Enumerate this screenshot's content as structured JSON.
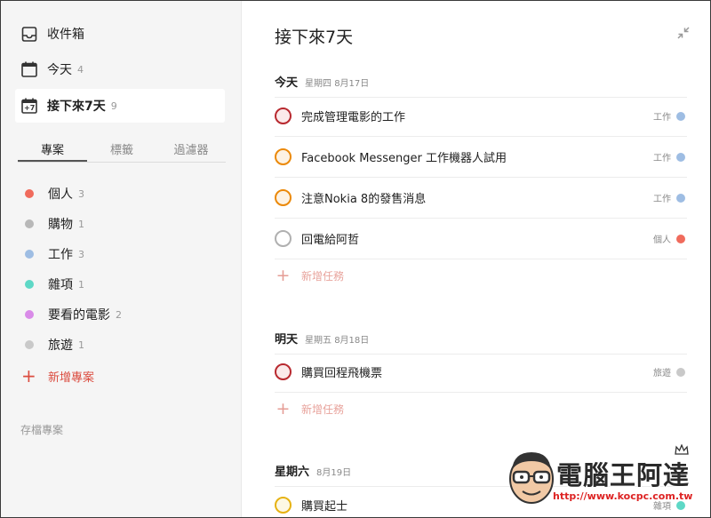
{
  "sidebar": {
    "nav": [
      {
        "label": "收件箱",
        "count": "",
        "icon": "inbox-icon"
      },
      {
        "label": "今天",
        "count": "4",
        "icon": "calendar-icon"
      },
      {
        "label": "接下來7天",
        "count": "9",
        "icon": "calendar-plus7-icon",
        "icon_text": "+7"
      }
    ],
    "tabs": [
      "專案",
      "標籤",
      "過濾器"
    ],
    "projects": [
      {
        "label": "個人",
        "count": "3",
        "color": "#f06b5c"
      },
      {
        "label": "購物",
        "count": "1",
        "color": "#b8b8b8"
      },
      {
        "label": "工作",
        "count": "3",
        "color": "#9ebde3"
      },
      {
        "label": "雜項",
        "count": "1",
        "color": "#5ed8c6"
      },
      {
        "label": "要看的電影",
        "count": "2",
        "color": "#d98be8"
      },
      {
        "label": "旅遊",
        "count": "1",
        "color": "#c9c9c9"
      }
    ],
    "add_project": "新增專案",
    "archive": "存檔專案"
  },
  "main": {
    "title": "接下來7天",
    "sections": [
      {
        "day": "今天",
        "date": "星期四 8月17日",
        "tasks": [
          {
            "title": "完成管理電影的工作",
            "project": "工作",
            "color": "#9ebde3",
            "priority": "p1"
          },
          {
            "title": "Facebook Messenger 工作機器人試用",
            "project": "工作",
            "color": "#9ebde3",
            "priority": "p2"
          },
          {
            "title": "注意Nokia 8的發售消息",
            "project": "工作",
            "color": "#9ebde3",
            "priority": "p2"
          },
          {
            "title": "回電給阿哲",
            "project": "個人",
            "color": "#f06b5c",
            "priority": "p4"
          }
        ],
        "add_task": "新增任務"
      },
      {
        "day": "明天",
        "date": "星期五 8月18日",
        "tasks": [
          {
            "title": "購買回程飛機票",
            "project": "旅遊",
            "color": "#c9c9c9",
            "priority": "p1"
          }
        ],
        "add_task": "新增任務"
      },
      {
        "day": "星期六",
        "date": "8月19日",
        "tasks": [
          {
            "title": "購買起士",
            "project": "雜項",
            "color": "#5ed8c6",
            "priority": "p3"
          }
        ]
      }
    ]
  },
  "watermark": {
    "text": "電腦王阿達",
    "url": "http://www.kocpc.com.tw"
  }
}
